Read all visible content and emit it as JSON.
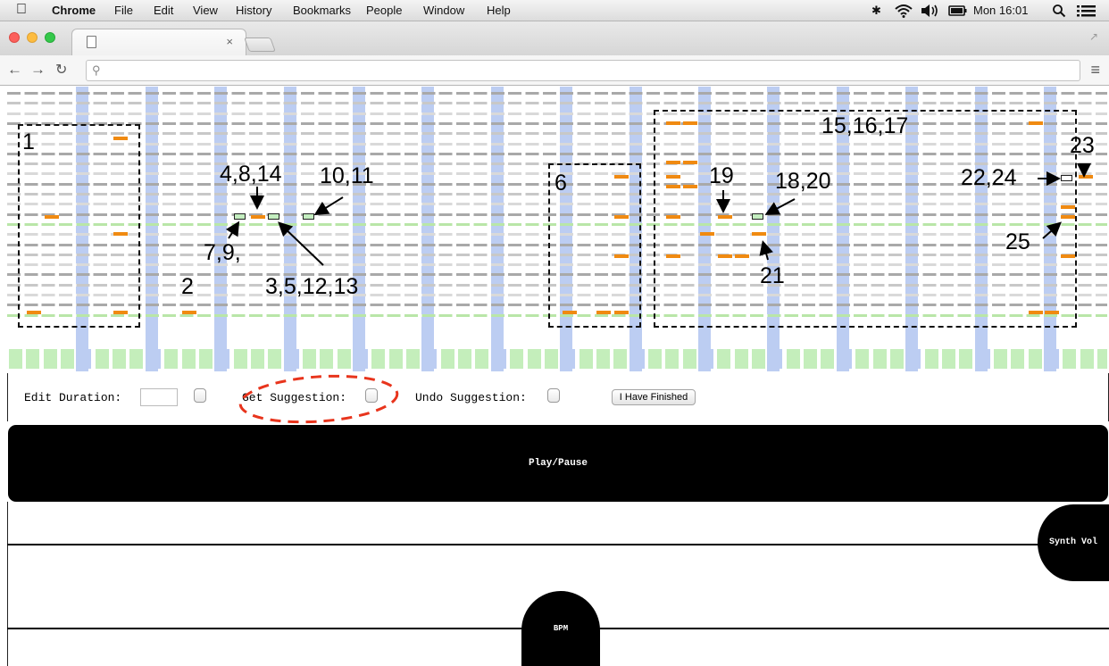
{
  "menubar": {
    "apple_icon": "apple-icon",
    "app_name": "Chrome",
    "items": [
      "File",
      "Edit",
      "View",
      "History",
      "Bookmarks",
      "People",
      "Window",
      "Help"
    ],
    "clock": "Mon 16:01",
    "status_icons": [
      "bluetooth-icon",
      "wifi-icon",
      "volume-icon",
      "battery-icon",
      "search-icon",
      "list-icon"
    ]
  },
  "browser": {
    "tab_close": "×",
    "traffic_colors": [
      "#fc605c",
      "#fdbc40",
      "#34c84a"
    ]
  },
  "grid": {
    "note_color": "#f08a11",
    "suggestion_color": "#c4eec0",
    "band_color": "#bccdf2",
    "beat_color": "#c4eebb"
  },
  "annotations": {
    "box1": "1",
    "box6": "6",
    "box15": "15,16,17",
    "a2": "2",
    "a3": "3,5,12,13",
    "a4": "4,8,14",
    "a7": "7,9,",
    "a10": "10,11",
    "a18": "18,20",
    "a19": "19",
    "a21": "21",
    "a22": "22,24",
    "a23": "23",
    "a25": "25"
  },
  "controls": {
    "edit_duration_label": "Edit Duration:",
    "edit_duration_value": "",
    "get_suggestion_label": "Get Suggestion:",
    "undo_suggestion_label": "Undo Suggestion:",
    "finish_button": "I Have Finished"
  },
  "player": {
    "play_label": "Play/Pause",
    "synth_vol_label": "Synth Vol",
    "bpm_label": "BPM"
  }
}
